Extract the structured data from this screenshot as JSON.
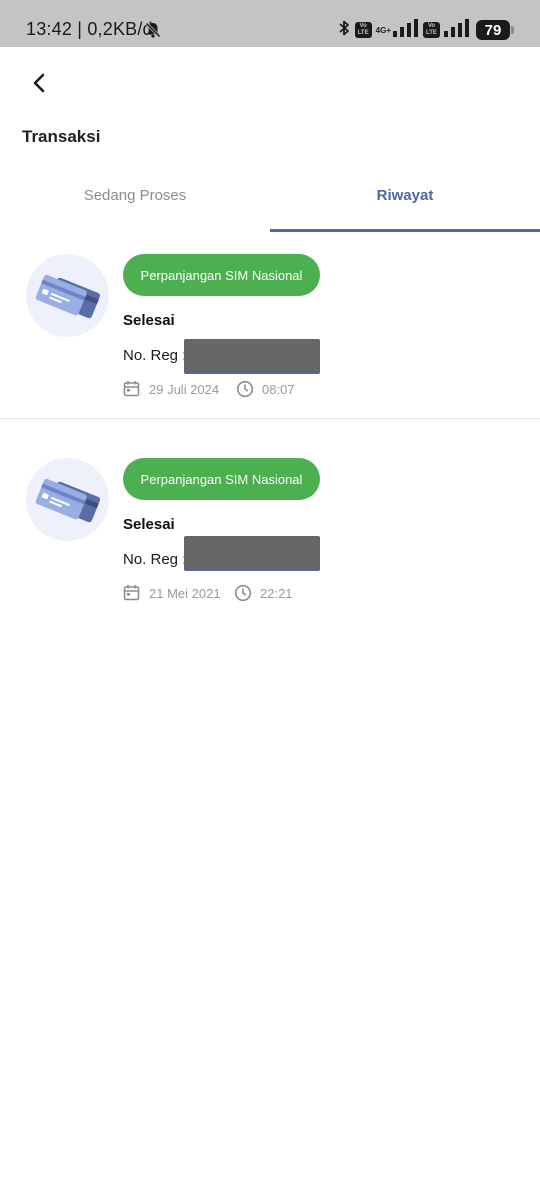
{
  "status_bar": {
    "time": "13:42 | 0,2KB/d",
    "network_label": "4G+",
    "volte_label": "Vo LTE",
    "battery": "79"
  },
  "header": {
    "title": "Transaksi"
  },
  "tabs": [
    {
      "label": "Sedang Proses",
      "active": false
    },
    {
      "label": "Riwayat",
      "active": true
    }
  ],
  "transactions": [
    {
      "service": "Perpanjangan SIM Nasional",
      "status": "Selesai",
      "reg_label": "No. Reg :",
      "date": "29 Juli 2024",
      "time": "08:07"
    },
    {
      "service": "Perpanjangan SIM Nasional",
      "status": "Selesai",
      "reg_label": "No. Reg :",
      "date": "21 Mei 2021",
      "time": "22:21"
    }
  ],
  "colors": {
    "accent": "#4c68a8",
    "badge_green": "#4caf50",
    "status_bar": "#c4c4c4",
    "redaction": "#676767"
  },
  "icons": [
    "back-arrow-icon",
    "bell-off-icon",
    "bluetooth-icon",
    "signal-icon",
    "battery-icon",
    "credit-card-icon",
    "calendar-icon",
    "clock-icon"
  ]
}
